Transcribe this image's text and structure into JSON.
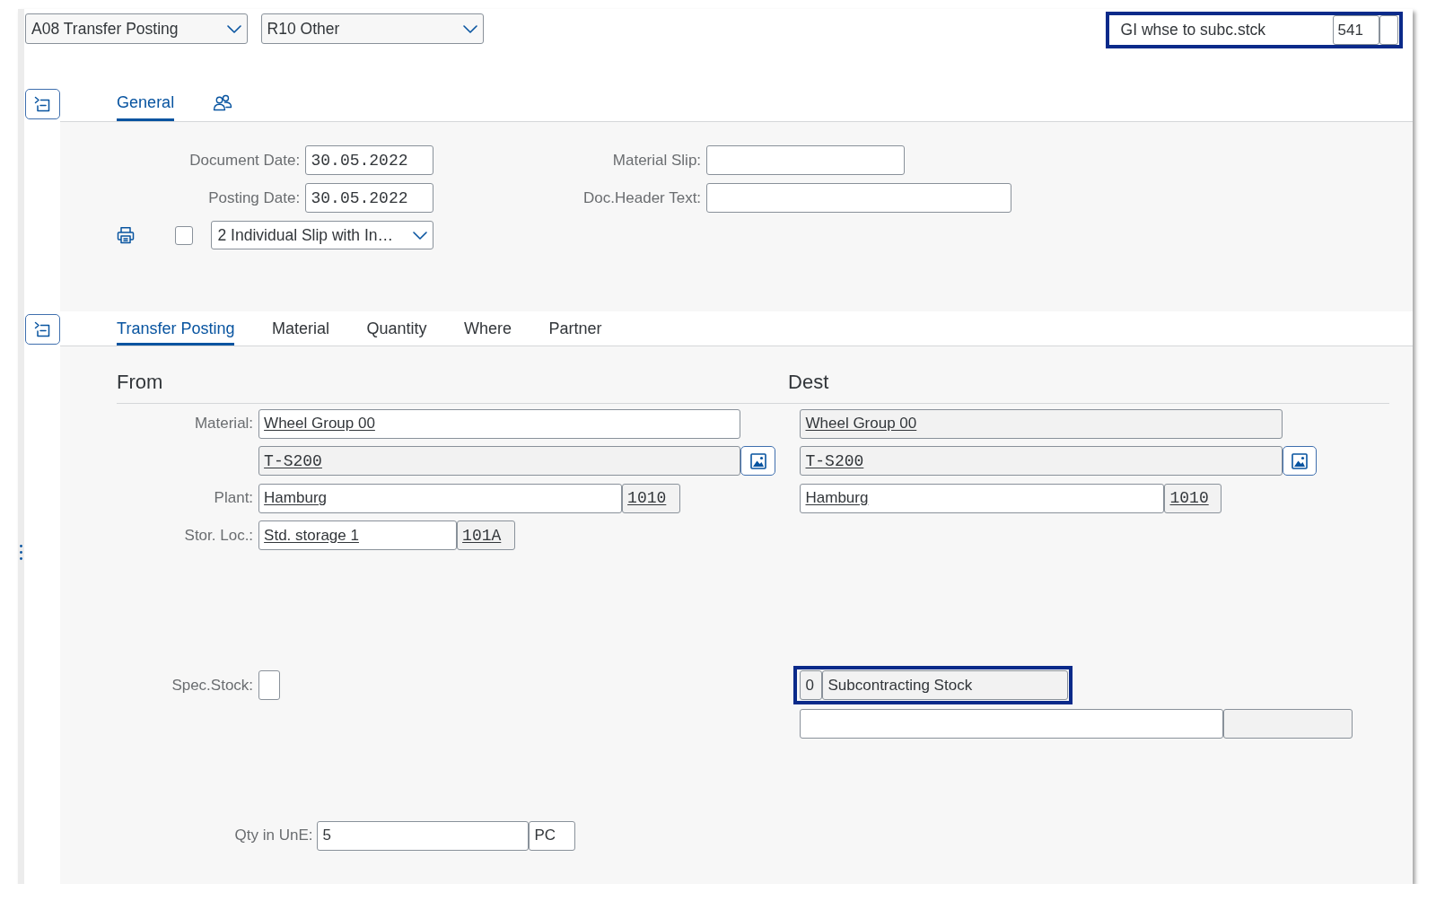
{
  "header": {
    "selects": [
      {
        "value": "A08 Transfer Posting"
      },
      {
        "value": "R10 Other"
      }
    ],
    "movement_type": {
      "highlighted": true,
      "description": "GI whse to subc.stck",
      "fields": [
        {
          "value": "541",
          "readonly": false
        },
        {
          "readonly": false
        }
      ]
    }
  },
  "general_section": {
    "tabs": [
      {
        "kind": "text",
        "label": "General",
        "selected": true
      },
      {
        "kind": "icon",
        "selected": false
      }
    ],
    "left_fields": [
      {
        "label": "Document Date:",
        "value": "30.05.2022",
        "kind": "date",
        "readonly": false
      },
      {
        "label": "Posting Date:",
        "value": "30.05.2022",
        "kind": "date",
        "readonly": false
      }
    ],
    "right_fields": [
      {
        "label": "Material Slip:",
        "readonly": false
      },
      {
        "label": "Doc.Header Text:",
        "readonly": false
      }
    ],
    "print_row": {
      "checked": false,
      "output_select": {
        "value": "2 Individual Slip with In…"
      }
    }
  },
  "item_section": {
    "tabs": [
      {
        "label": "Transfer Posting",
        "selected": true
      },
      {
        "label": "Material",
        "selected": false
      },
      {
        "label": "Quantity",
        "selected": false
      },
      {
        "label": "Where",
        "selected": false
      },
      {
        "label": "Partner",
        "selected": false
      }
    ],
    "from_title": "From",
    "dest_title": "Dest",
    "rows": [
      {
        "kind": "material",
        "label": "Material:",
        "from": [
          {
            "kind": "text",
            "value": "Wheel Group 00",
            "link": true,
            "readonly": false
          }
        ],
        "dest": [
          {
            "kind": "text",
            "value": "Wheel Group 00",
            "link": true,
            "readonly": true
          }
        ]
      },
      {
        "kind": "material_number",
        "from": [
          {
            "kind": "code",
            "value": "T-S200",
            "link": true,
            "readonly": true
          },
          {
            "kind": "image_button"
          }
        ],
        "dest": [
          {
            "kind": "code",
            "value": "T-S200",
            "link": true,
            "readonly": true
          },
          {
            "kind": "image_button"
          }
        ]
      },
      {
        "kind": "plant",
        "label": "Plant:",
        "from": [
          {
            "kind": "text",
            "value": "Hamburg",
            "link": true,
            "readonly": false
          },
          {
            "kind": "code",
            "value": "1010",
            "link": true,
            "readonly": true
          }
        ],
        "dest": [
          {
            "kind": "text",
            "value": "Hamburg",
            "link": true,
            "readonly": false
          },
          {
            "kind": "code",
            "value": "1010",
            "link": true,
            "readonly": true
          }
        ]
      },
      {
        "kind": "storage_location",
        "label": "Stor. Loc.:",
        "from": [
          {
            "kind": "text",
            "value": "Std. storage 1",
            "link": true,
            "readonly": false
          },
          {
            "kind": "code",
            "value": "101A",
            "link": true,
            "readonly": true
          }
        ]
      },
      {
        "kind": "special_stock",
        "label": "Spec.Stock:",
        "from": [
          {
            "readonly": false
          }
        ],
        "dest_highlighted": true,
        "dest": [
          {
            "kind": "text",
            "value": "0",
            "link": false,
            "readonly": true
          },
          {
            "kind": "text",
            "value": "Subcontracting Stock",
            "link": false,
            "readonly": true
          }
        ]
      },
      {
        "kind": "special_stock_detail",
        "dest": [
          {
            "readonly": false
          },
          {
            "readonly": true
          }
        ]
      },
      {
        "kind": "quantity",
        "label": "Qty in UnE:",
        "from": [
          {
            "kind": "text",
            "value": "5",
            "link": false,
            "readonly": false
          },
          {
            "kind": "text",
            "value": "PC",
            "link": false,
            "readonly": false
          }
        ]
      }
    ]
  }
}
